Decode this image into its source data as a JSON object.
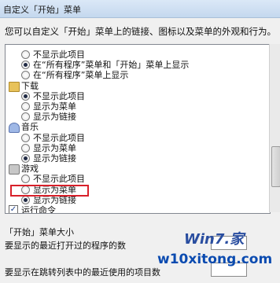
{
  "window": {
    "title": "自定义「开始」菜单"
  },
  "intro": "您可以自定义「开始」菜单上的链接、图标以及菜单的外观和行为。",
  "options": [
    {
      "kind": "radio",
      "label": "不显示此项目",
      "checked": false
    },
    {
      "kind": "radio",
      "label": "在“所有程序”菜单和「开始」菜单上显示",
      "checked": true
    },
    {
      "kind": "radio",
      "label": "在“所有程序”菜单上显示",
      "checked": false
    },
    {
      "kind": "group",
      "icon": "folder-icon",
      "label": "下载"
    },
    {
      "kind": "radio",
      "label": "不显示此项目",
      "checked": true
    },
    {
      "kind": "radio",
      "label": "显示为菜单",
      "checked": false
    },
    {
      "kind": "radio",
      "label": "显示为链接",
      "checked": false
    },
    {
      "kind": "group",
      "icon": "music-icon",
      "label": "音乐"
    },
    {
      "kind": "radio",
      "label": "不显示此项目",
      "checked": false
    },
    {
      "kind": "radio",
      "label": "显示为菜单",
      "checked": false
    },
    {
      "kind": "radio",
      "label": "显示为链接",
      "checked": true
    },
    {
      "kind": "group",
      "icon": "games-icon",
      "label": "游戏"
    },
    {
      "kind": "radio",
      "label": "不显示此项目",
      "checked": false
    },
    {
      "kind": "radio",
      "label": "显示为菜单",
      "checked": false
    },
    {
      "kind": "radio",
      "label": "显示为链接",
      "checked": true
    },
    {
      "kind": "checkbox",
      "label": "运行命令",
      "checked": true
    },
    {
      "kind": "checkbox",
      "label": "最近使用的项目",
      "checked": false
    }
  ],
  "start_menu_size_label": "「开始」菜单大小",
  "recent_programs_label": "要显示的最近打开过的程序的数",
  "jump_list_label": "要显示在跳转列表中的最近使用的项目数",
  "watermark": {
    "top": "Win7.家",
    "bottom": "w10xitong.com"
  }
}
